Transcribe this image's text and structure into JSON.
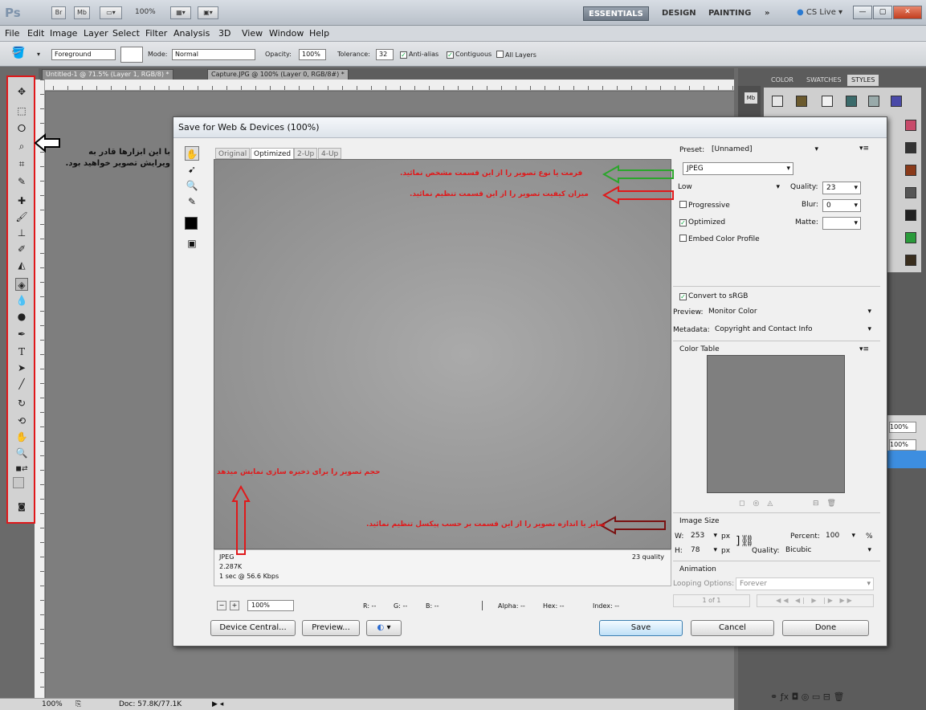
{
  "app": {
    "logo": "Ps",
    "badge_br": "Br",
    "badge_mb": "Mb",
    "zoom": "100%",
    "workspaces": {
      "essentials": "ESSENTIALS",
      "design": "DESIGN",
      "painting": "PAINTING",
      "more": "»"
    },
    "cslive": "CS Live ▾"
  },
  "menu": [
    "File",
    "Edit",
    "Image",
    "Layer",
    "Select",
    "Filter",
    "Analysis",
    "3D",
    "View",
    "Window",
    "Help"
  ],
  "options": {
    "fill_source": "Foreground",
    "mode_label": "Mode:",
    "mode_value": "Normal",
    "opacity_label": "Opacity:",
    "opacity_value": "100%",
    "tolerance_label": "Tolerance:",
    "tolerance_value": "32",
    "antialias": "Anti-alias",
    "contiguous": "Contiguous",
    "all_layers": "All Layers"
  },
  "tabs": [
    "Untitled-1 @ 71.5% (Layer 1, RGB/8) *",
    "Capture.JPG @ 100% (Layer 0, RGB/8#) *"
  ],
  "status": {
    "zoom": "100%",
    "doc": "Doc: 57.8K/77.1K"
  },
  "panel": {
    "tabs": [
      "COLOR",
      "SWATCHES",
      "STYLES"
    ],
    "pct1": "100%",
    "pct2": "100%",
    "mb": "Mb"
  },
  "dialog": {
    "title": "Save for Web & Devices (100%)",
    "view_tabs": [
      "Original",
      "Optimized",
      "2-Up",
      "4-Up"
    ],
    "info": {
      "format": "JPEG",
      "size": "2.287K",
      "time": "1 sec @ 56.6 Kbps",
      "quality": "23 quality"
    },
    "zoom": "100%",
    "readouts": [
      "R: --",
      "G: --",
      "B: --",
      "Alpha: --",
      "Hex: --",
      "Index: --"
    ],
    "buttons": {
      "device_central": "Device Central...",
      "preview": "Preview...",
      "save": "Save",
      "cancel": "Cancel",
      "done": "Done"
    },
    "settings": {
      "preset_label": "Preset:",
      "preset_value": "[Unnamed]",
      "format": "JPEG",
      "quality_level": "Low",
      "quality_label": "Quality:",
      "quality_value": "23",
      "progressive": "Progressive",
      "blur_label": "Blur:",
      "blur_value": "0",
      "optimized": "Optimized",
      "matte_label": "Matte:",
      "embed": "Embed Color Profile",
      "convert": "Convert to sRGB",
      "preview_label": "Preview:",
      "preview_value": "Monitor Color",
      "metadata_label": "Metadata:",
      "metadata_value": "Copyright and Contact Info",
      "color_table": "Color Table",
      "image_size": "Image Size",
      "w_label": "W:",
      "w_value": "253",
      "h_label": "H:",
      "h_value": "78",
      "px": "px",
      "percent_label": "Percent:",
      "percent_value": "100",
      "pct": "%",
      "resample_label": "Quality:",
      "resample_value": "Bicubic",
      "animation": "Animation",
      "looping_label": "Looping Options:",
      "looping_value": "Forever",
      "frame": "1 of 1"
    }
  },
  "annotations": {
    "tools": "با این ابزارها قادر به ویرایش تصویر خواهید بود.",
    "format": "فرمت یا نوع تصویر را از این قسمت مشخص نمائید.",
    "quality": "میزان کیفیت تصویر را از این قسمت تنظیم نمائید.",
    "filesize": "حجم تصویر را برای ذخیره سازی نمایش میدهد",
    "imagesize": "سایز یا اندازه تصویر را از این قسمت بر حسب پیکسل تنظیم نمائید."
  },
  "colors": {
    "annotation_red": "#e0191b",
    "arrow_green": "#2ca62c",
    "arrow_darkred": "#7a1212",
    "accent": "#3c7fb1"
  }
}
